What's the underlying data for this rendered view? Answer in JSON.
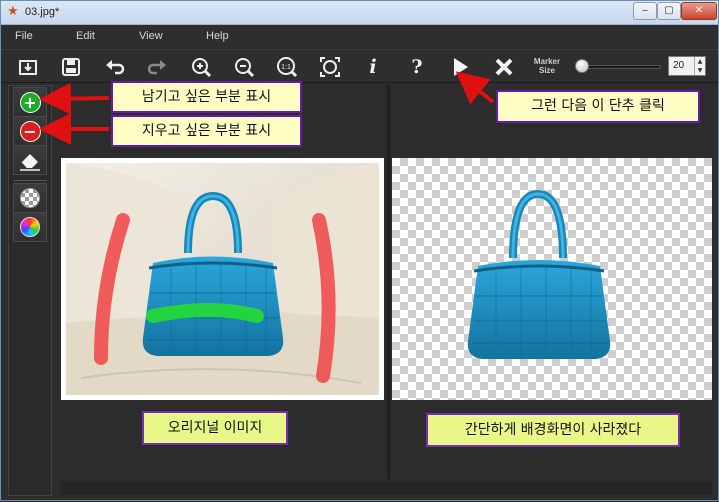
{
  "window": {
    "title": "03.jpg*",
    "app_icon": "star-icon",
    "controls": {
      "minimize": "‒",
      "maximize": "▢",
      "close": "✕"
    }
  },
  "menu": {
    "items": [
      "File",
      "Edit",
      "View",
      "Help"
    ]
  },
  "toolbar": {
    "tools": [
      {
        "name": "open-folder-icon"
      },
      {
        "name": "save-icon"
      },
      {
        "name": "undo-icon"
      },
      {
        "name": "redo-icon"
      },
      {
        "name": "zoom-in-icon"
      },
      {
        "name": "zoom-out-icon"
      },
      {
        "name": "zoom-actual-size-icon",
        "label": "1:1"
      },
      {
        "name": "fit-to-window-icon"
      },
      {
        "name": "info-icon",
        "label": "i"
      },
      {
        "name": "help-icon",
        "label": "?"
      },
      {
        "name": "play-icon"
      },
      {
        "name": "close-x-icon"
      }
    ],
    "marker_size_label_1": "Marker",
    "marker_size_label_2": "Size",
    "marker_size_value": "20",
    "marker_slider_level": 0.05
  },
  "left_tools": {
    "keep_marker": "plus-circle-icon",
    "remove_marker": "minus-circle-icon",
    "eraser": "eraser-icon",
    "transparency": "checkerboard-icon",
    "color": "color-wheel-icon"
  },
  "callouts": {
    "keep": "남기고 싶은 부분 표시",
    "remove": "지우고 싶은 부분 표시",
    "run": "그런 다음 이 단추 클릭"
  },
  "captions": {
    "original": "오리지널 이미지",
    "result": "간단하게 배경화면이 사라졌다"
  },
  "colors": {
    "callout_fill": "#fdfdc4",
    "callout_border": "#6a1aa8",
    "caption_fill": "#e8f888",
    "arrow": "#e01010",
    "keep_marker": "#22dd33",
    "remove_marker": "#f05050",
    "bag_blue": "#1e8fc4"
  }
}
